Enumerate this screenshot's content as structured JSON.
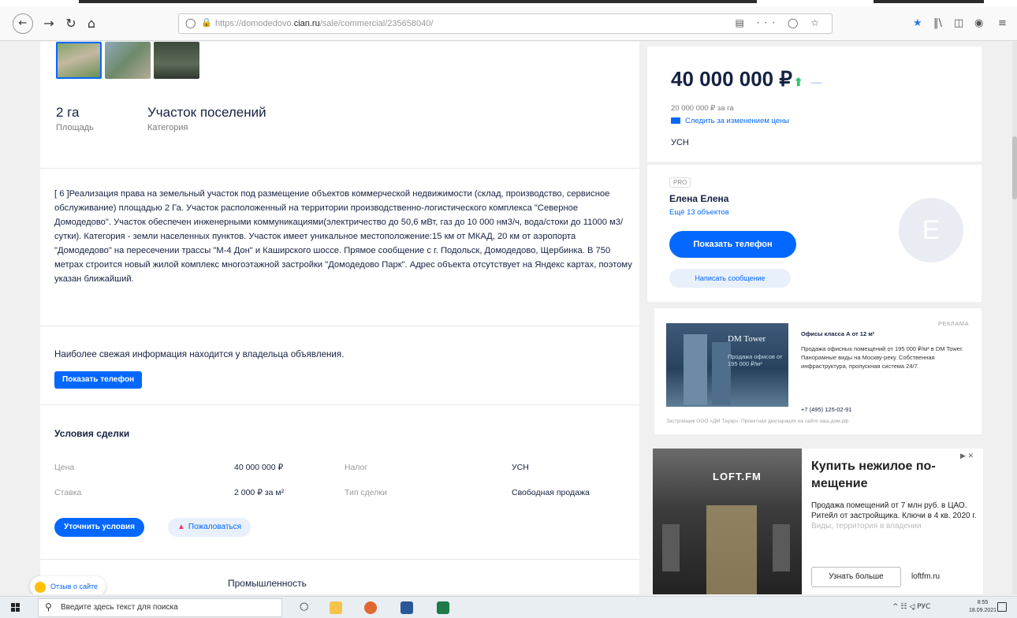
{
  "browser": {
    "url_prefix": "https://domodedovo.",
    "url_domain": "cian.ru",
    "url_path": "/sale/commercial/235658040/",
    "menu_dots": "···"
  },
  "gallery": {
    "thumbnails": [
      "photo-1",
      "photo-2",
      "photo-3"
    ]
  },
  "stats": [
    {
      "value": "2 га",
      "label": "Площадь"
    },
    {
      "value": "Участок поселений",
      "label": "Категория"
    }
  ],
  "description": "[ 6 ]Реализация права на земельный участок под размещение объектов коммерческой недвижимости (склад, производство, сервисное обслуживание) площадью 2 Га. Участок расположенный на территории производственно-логистического комплекса \"Северное Домодедово\". Участок обеспечен инженерными коммуникациями(электричество до 50,6 мВт, газ до 10 000 нм3/ч, вода/стоки до 11000 м3/сутки). Категория - земли населенных пунктов. Участок имеет уникальное местоположение:15 км от МКАД, 20 км от аэропорта \"Домодедово\" на пересечении трассы \"М-4 Дон\" и Каширского шоссе. Прямое сообщение с г. Подольск, Домодедово, Щербинка. В 750 метрах строится новый жилой комплекс многоэтажной застройки \"Домодедово Парк\". Адрес объекта отсутствует на Яндекс картах, поэтому указан ближайший.",
  "owner_note": "Наиболее свежая информация находится у владельца объявления.",
  "show_phone_small": "Показать телефон",
  "conditions": {
    "title": "Условия сделки",
    "rows": [
      {
        "k1": "Цена",
        "v1": "40 000 000 ₽",
        "k2": "Налог",
        "v2": "УСН"
      },
      {
        "k1": "Ставка",
        "v1": "2 000 ₽ за м²",
        "k2": "Тип сделки",
        "v2": "Свободная продажа"
      }
    ],
    "clarify_button": "Уточнить условия",
    "complain_button": "Пожаловаться"
  },
  "industry": "Промышленность",
  "price": {
    "value": "40 000 000 ₽",
    "per_unit": "20 000 000 ₽ за га",
    "follow": "Следить за изменением цены",
    "tax": "УСН"
  },
  "agent": {
    "badge": "PRO",
    "name": "Елена Елена",
    "more_link": "Ещё 13 объектов",
    "show_phone": "Показать телефон",
    "write": "Написать сообщение",
    "avatar_letter": "E"
  },
  "ad1": {
    "tag": "РЕКЛАМА",
    "brand": "DM Tower",
    "overlay": "Продажа офисов от 195 000 ₽/м²",
    "title": "Офисы класса А от 12 м²",
    "text": "Продажа офисных помещений от 195 000 ₽/м² в DM Tower. Панорамные виды на Москву-реку. Собственная инфраструктура, пропускная система 24/7.",
    "phone": "+7 (495) 125-02-91",
    "footer": "Застройщик ООО «ДМ Тауэр». Проектная декларация на сайте наш.дом.рф"
  },
  "ad2": {
    "logo": "LOFT.FM",
    "close": "▶ ✕",
    "title": "Купить нежилое по-мещение",
    "text": "Продажа помещений от 7 млн руб. в ЦАО. Ритейл от застройщика. Ключи в 4 кв. 2020 г.",
    "text_fade": "Виды, территория в владении",
    "button": "Узнать больше",
    "domain": "loftfm.ru"
  },
  "feedback": "Отзыв о сайте",
  "taskbar": {
    "search_placeholder": "Введите здесь текст для поиска",
    "tray": "^ ☷ ◁͉ РУС",
    "time": "8:55",
    "date": "18.09.2021"
  },
  "colors": {
    "accent": "#0468ff",
    "text": "#152242",
    "muted": "#7a7a7a",
    "green": "#2fc46b"
  }
}
